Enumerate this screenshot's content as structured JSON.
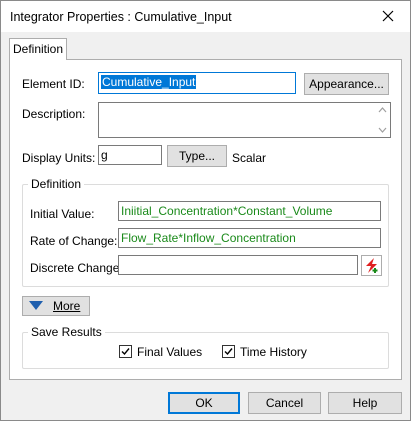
{
  "window": {
    "title": "Integrator Properties : Cumulative_Input"
  },
  "tabs": [
    {
      "label": "Definition"
    }
  ],
  "element_id": {
    "label": "Element ID:",
    "value": "Cumulative_Input"
  },
  "appearance_button": "Appearance...",
  "description": {
    "label": "Description:",
    "value": ""
  },
  "display_units": {
    "label": "Display Units:",
    "value": "g",
    "type_button": "Type...",
    "type_value": "Scalar"
  },
  "definition_group": {
    "title": "Definition",
    "initial_value": {
      "label": "Initial Value:",
      "value": "Iniitial_Concentration*Constant_Volume"
    },
    "rate_of_change": {
      "label": "Rate of Change:",
      "value": "Flow_Rate*Inflow_Concentration"
    },
    "discrete_change": {
      "label": "Discrete Change:",
      "value": ""
    }
  },
  "more_button": "More",
  "save_results": {
    "title": "Save Results",
    "final_values": {
      "label": "Final Values",
      "checked": true
    },
    "time_history": {
      "label": "Time History",
      "checked": true
    }
  },
  "buttons": {
    "ok": "OK",
    "cancel": "Cancel",
    "help": "Help"
  },
  "colors": {
    "accent": "#0078d7",
    "expression_text": "#1a8a1a",
    "discrete_icon": "#e02020"
  }
}
